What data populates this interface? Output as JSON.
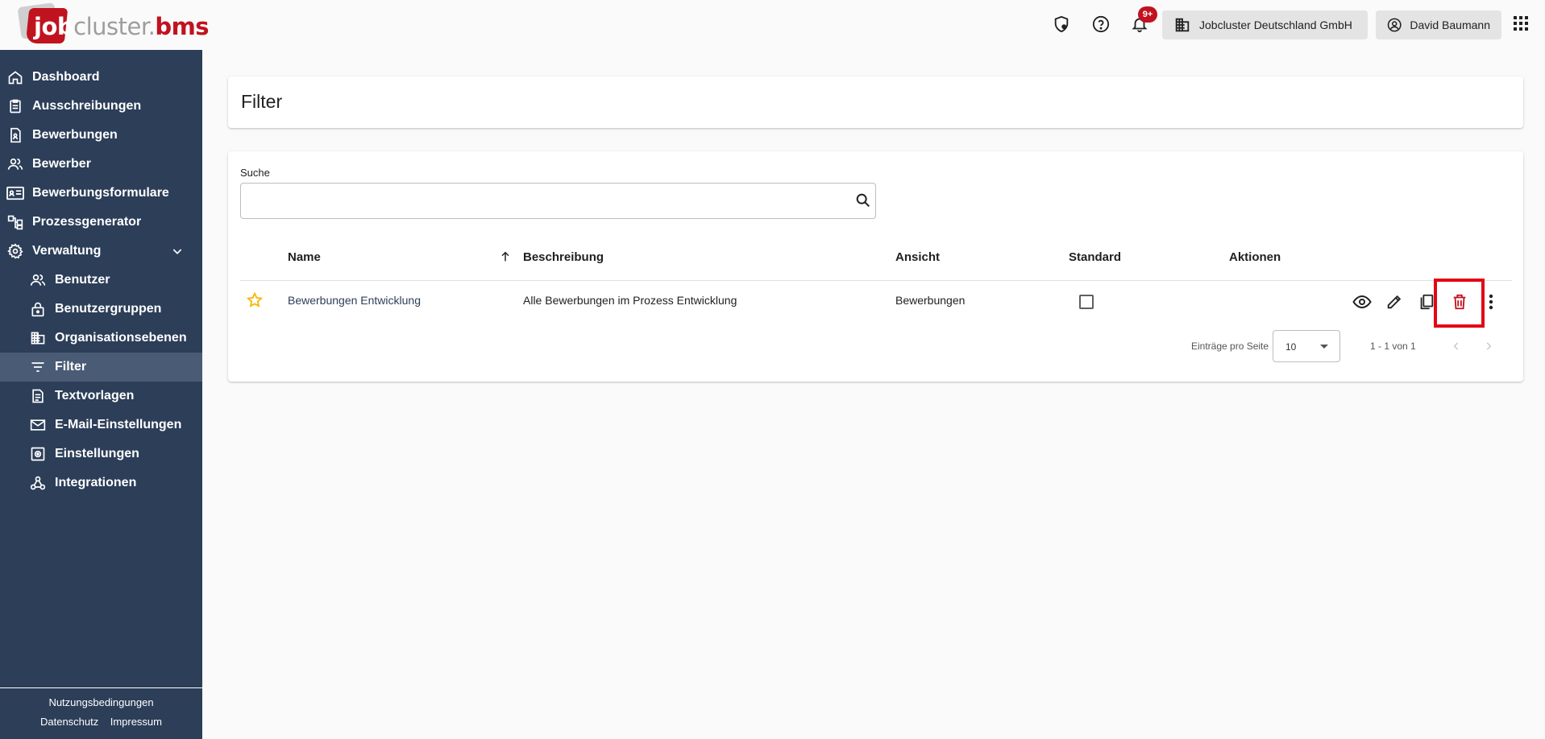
{
  "app": {
    "logo": {
      "part1": "job",
      "part2": "cluster",
      "dot": ".",
      "part3": "bms"
    }
  },
  "header": {
    "notification_count": "9+",
    "company": "Jobcluster Deutschland GmbH",
    "user": "David Baumann"
  },
  "sidebar": {
    "items": [
      {
        "label": "Dashboard",
        "icon": "home-icon"
      },
      {
        "label": "Ausschreibungen",
        "icon": "clipboard-icon"
      },
      {
        "label": "Bewerbungen",
        "icon": "application-icon"
      },
      {
        "label": "Bewerber",
        "icon": "people-icon"
      },
      {
        "label": "Bewerbungsformulare",
        "icon": "form-icon"
      },
      {
        "label": "Prozessgenerator",
        "icon": "process-icon"
      },
      {
        "label": "Verwaltung",
        "icon": "gear-icon"
      }
    ],
    "sub_items": [
      {
        "label": "Benutzer",
        "icon": "people-icon"
      },
      {
        "label": "Benutzergruppen",
        "icon": "lock-icon"
      },
      {
        "label": "Organisationsebenen",
        "icon": "building-icon"
      },
      {
        "label": "Filter",
        "icon": "filter-icon",
        "active": true
      },
      {
        "label": "Textvorlagen",
        "icon": "document-icon"
      },
      {
        "label": "E-Mail-Einstellungen",
        "icon": "mail-icon"
      },
      {
        "label": "Einstellungen",
        "icon": "settings-box-icon"
      },
      {
        "label": "Integrationen",
        "icon": "webhook-icon"
      }
    ],
    "footer": {
      "terms": "Nutzungsbedingungen",
      "privacy": "Datenschutz",
      "imprint": "Impressum"
    }
  },
  "main": {
    "title": "Filter",
    "search": {
      "label": "Suche",
      "value": "",
      "placeholder": ""
    },
    "table": {
      "columns": [
        "Name",
        "Beschreibung",
        "Ansicht",
        "Standard",
        "Aktionen"
      ],
      "sort": {
        "column": "Name",
        "direction": "ascending"
      },
      "rows": [
        {
          "favorite": true,
          "name": "Bewerbungen Entwicklung",
          "description": "Alle Bewerbungen im Prozess Entwicklung",
          "view": "Bewerbungen",
          "standard": false,
          "actions": [
            "eye-icon",
            "pencil-icon",
            "copy-icon",
            "trash-icon",
            "more-vert-icon"
          ]
        }
      ]
    },
    "pagination": {
      "per_page_label": "Einträge pro Seite",
      "per_page_value": "10",
      "range": "1 - 1 von 1"
    }
  },
  "colors": {
    "brand_red": "#c1121f",
    "sidebar_bg": "#2c3e58",
    "sidebar_active": "#4a5b75",
    "highlight_box": "#e30613",
    "delete_icon": "#c1121f",
    "star": "#f5b700"
  }
}
